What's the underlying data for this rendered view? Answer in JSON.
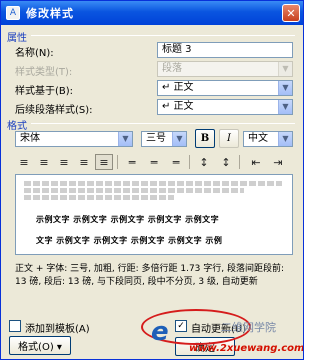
{
  "window": {
    "title": "修改样式",
    "close_glyph": "✕",
    "icon_glyph": "A"
  },
  "properties": {
    "group_label": "属性",
    "name_label": "名称(N):",
    "name_value": "标题 3",
    "style_type_label": "样式类型(T):",
    "style_type_value": "段落",
    "based_on_label": "样式基于(B):",
    "based_on_value": "↵ 正文",
    "next_style_label": "后续段落样式(S):",
    "next_style_value": "↵ 正文"
  },
  "format": {
    "group_label": "格式",
    "font": "宋体",
    "size": "三号",
    "bold_label": "B",
    "italic_label": "I",
    "script": "中文",
    "align_left": "≡",
    "align_center": "≡",
    "align_right": "≡",
    "align_distributed": "≡",
    "align_justify": "≡",
    "spacing_single": "═",
    "spacing_1_5": "═",
    "spacing_double": "═",
    "para_space_inc": "↕",
    "para_space_dec": "↕",
    "indent_dec": "⇤",
    "indent_inc": "⇥"
  },
  "preview": {
    "sample_line_1": "示例文字  示例文字  示例文字  示例文字  示例文字",
    "sample_line_2": "文字  示例文字  示例文字  示例文字  示例文字  示例"
  },
  "description": "正文 + 字体: 三号, 加粗, 行距: 多倍行距 1.73 字行, 段落间距段前: 13 磅, 段后: 13 磅, 与下段同页, 段中不分页, 3 级, 自动更新",
  "options": {
    "add_to_template_label": "添加到模板(A)",
    "auto_update_label": "自动更新(U)",
    "format_button": "格式(O) ▾",
    "ok_button": "确定"
  },
  "watermark": {
    "e": "e",
    "chinese": "二维网学院",
    "url": "www.2xuewang.com"
  },
  "colors": {
    "title_bar": "#0a55e0",
    "group_label": "#1c40c0",
    "dialog_bg": "#ece9d8",
    "annotation": "#d51c1c"
  }
}
